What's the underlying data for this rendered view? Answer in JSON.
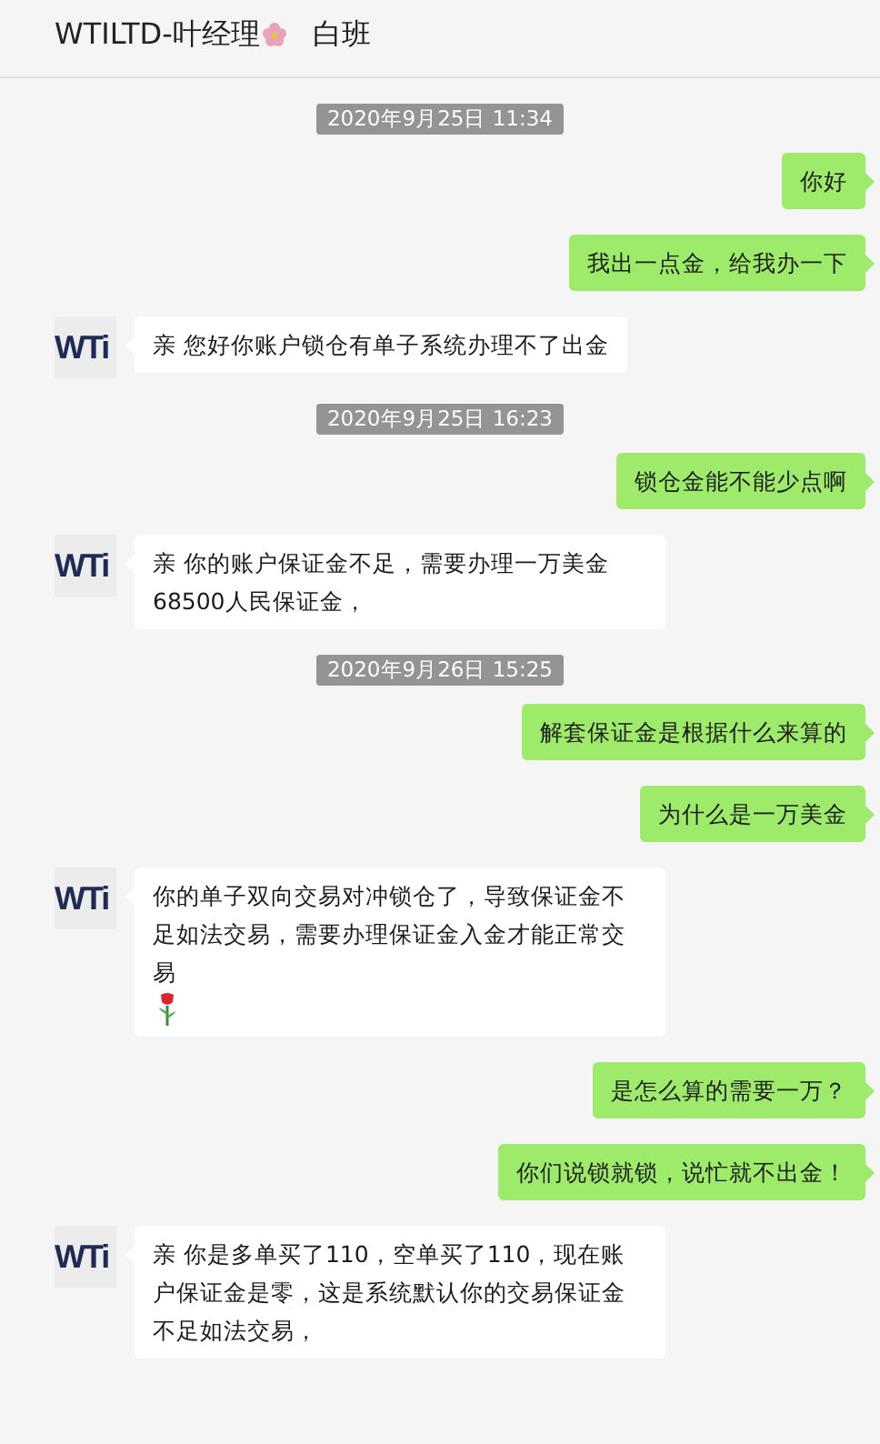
{
  "header": {
    "title": "WTILTD-叶经理",
    "title_flower": true,
    "status": "白班"
  },
  "messages": [
    {
      "kind": "timestamp",
      "text": "2020年9月25日 11:34"
    },
    {
      "kind": "sent",
      "text": "你好"
    },
    {
      "kind": "sent",
      "text": "我出一点金，给我办一下"
    },
    {
      "kind": "received",
      "avatar": "WTi",
      "text": "亲 您好你账户锁仓有单子系统办理不了出金"
    },
    {
      "kind": "timestamp",
      "text": "2020年9月25日 16:23"
    },
    {
      "kind": "sent",
      "text": "锁仓金能不能少点啊"
    },
    {
      "kind": "received",
      "avatar": "WTi",
      "text": "亲 你的账户保证金不足，需要办理一万美金68500人民保证金，"
    },
    {
      "kind": "timestamp",
      "text": "2020年9月26日 15:25"
    },
    {
      "kind": "sent",
      "text": "解套保证金是根据什么来算的"
    },
    {
      "kind": "sent",
      "text": "为什么是一万美金"
    },
    {
      "kind": "received",
      "avatar": "WTi",
      "text": "你的单子双向交易对冲锁仓了，导致保证金不足如法交易，需要办理保证金入金才能正常交易",
      "rose": true
    },
    {
      "kind": "sent",
      "text": "是怎么算的需要一万？"
    },
    {
      "kind": "sent",
      "text": "你们说锁就锁，说忙就不出金！"
    },
    {
      "kind": "received",
      "avatar": "WTi",
      "text": "亲 你是多单买了110，空单买了110，现在账户保证金是零，这是系统默认你的交易保证金不足如法交易，"
    }
  ]
}
